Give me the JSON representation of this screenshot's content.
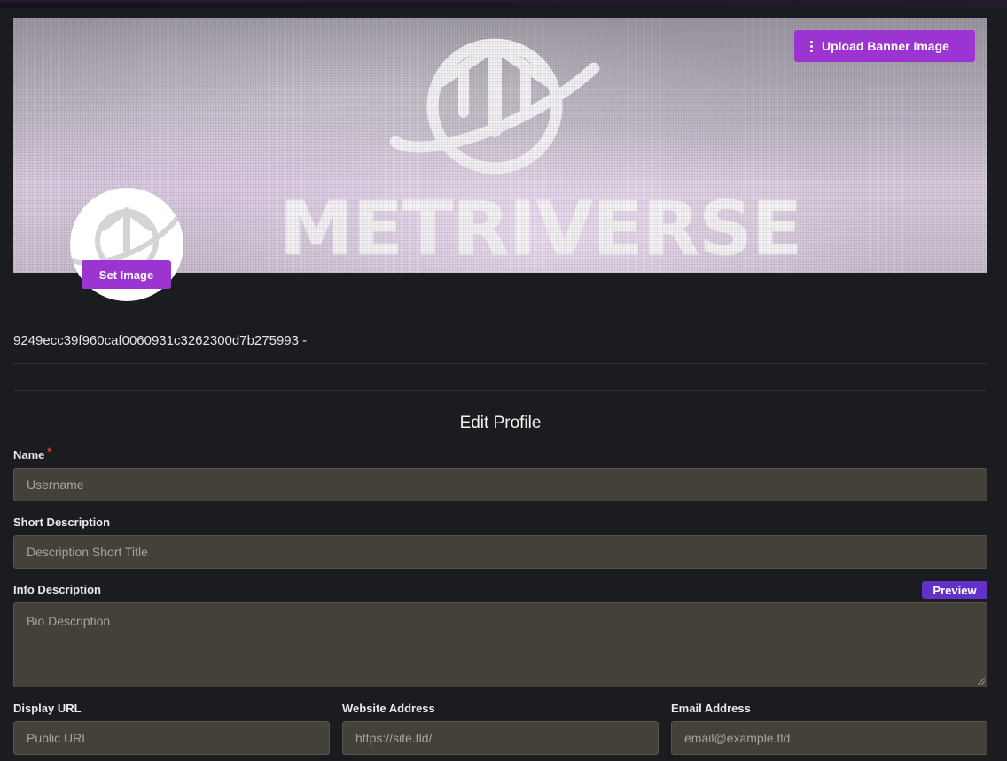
{
  "banner": {
    "upload_label": "Upload Banner Image",
    "upload_icon": "more-vertical-icon",
    "wordmark": "METRIVERSE"
  },
  "avatar": {
    "set_image_label": "Set Image"
  },
  "wallet": {
    "address": "9249ecc39f960caf0060931c3262300d7b275993 -"
  },
  "form": {
    "title": "Edit Profile",
    "name": {
      "label": "Name",
      "required_mark": "*",
      "value": "",
      "placeholder": "Username"
    },
    "short_description": {
      "label": "Short Description",
      "value": "",
      "placeholder": "Description Short Title"
    },
    "info_description": {
      "label": "Info Description",
      "preview_label": "Preview",
      "value": "",
      "placeholder": "Bio Description"
    },
    "display_url": {
      "label": "Display URL",
      "value": "",
      "placeholder": "Public URL"
    },
    "website": {
      "label": "Website Address",
      "value": "",
      "placeholder": "https://site.tld/"
    },
    "email": {
      "label": "Email Address",
      "value": "",
      "placeholder": "email@example.tld"
    }
  },
  "colors": {
    "accent_purple": "#9b34d0",
    "preview_purple": "#6231c8",
    "field_bg": "#44403a",
    "page_bg": "#1b1c1f",
    "required_red": "#e0443b"
  }
}
